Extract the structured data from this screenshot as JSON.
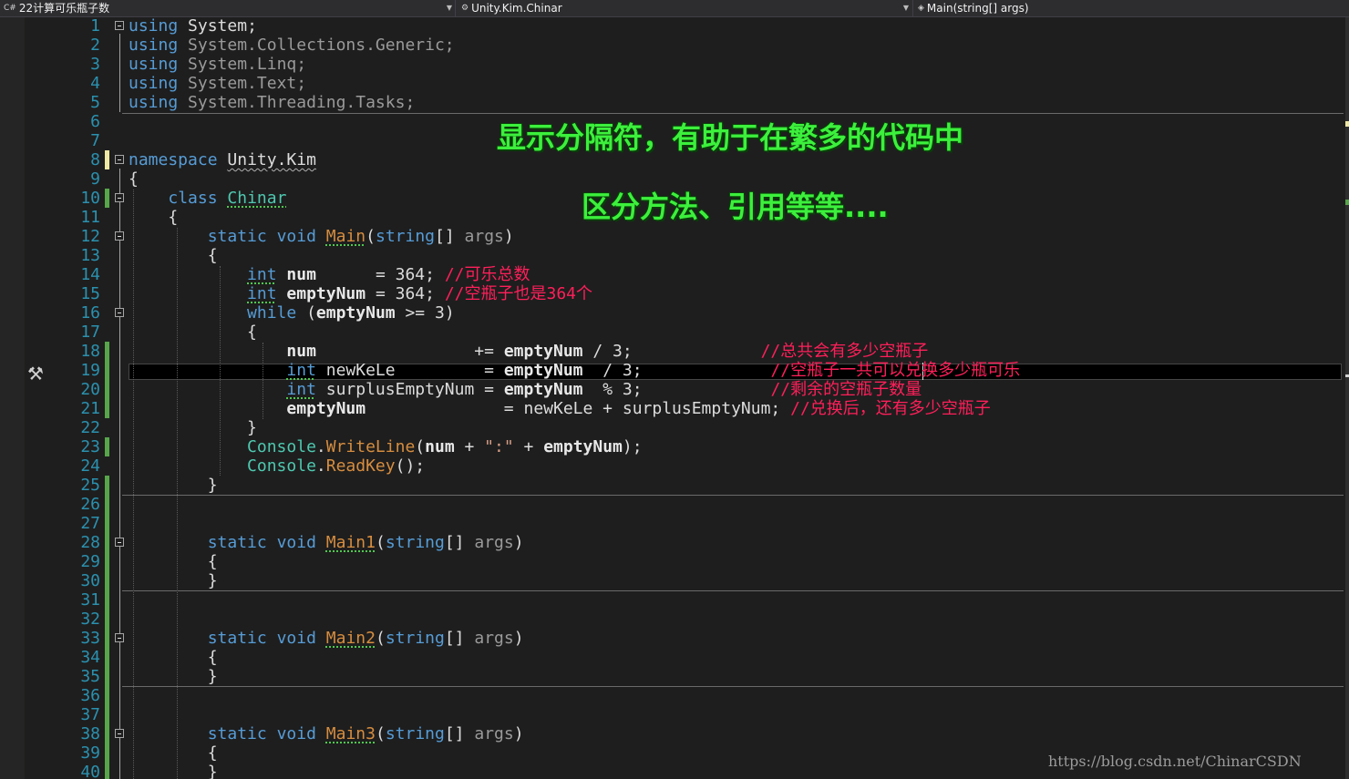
{
  "navbar": {
    "project_icon": "C#",
    "project": "22计算可乐瓶子数",
    "class_icon": "class-icon",
    "class_name": "Unity.Kim.Chinar",
    "member_icon": "method-icon",
    "member": "Main(string[] args)"
  },
  "overlay": {
    "line1": "显示分隔符，有助于在繁多的代码中",
    "line2": "区分方法、引用等等...."
  },
  "watermark": "https://blog.csdn.net/ChinarCSDN",
  "tool_icon": "hammer-icon",
  "line_numbers": [
    "1",
    "2",
    "3",
    "4",
    "5",
    "6",
    "7",
    "8",
    "9",
    "10",
    "11",
    "12",
    "13",
    "14",
    "15",
    "16",
    "17",
    "18",
    "19",
    "20",
    "21",
    "22",
    "23",
    "24",
    "25",
    "26",
    "27",
    "28",
    "29",
    "30",
    "31",
    "32",
    "33",
    "34",
    "35",
    "36",
    "37",
    "38",
    "39",
    "40"
  ],
  "code": {
    "using": "using",
    "ns_system": "System",
    "ns_collections": "System.Collections.Generic",
    "ns_linq": "System.Linq",
    "ns_text": "System.Text",
    "ns_tasks": "System.Threading.Tasks",
    "kw_namespace": "namespace",
    "ns_name": "Unity.Kim",
    "kw_class": "class",
    "class_name": "Chinar",
    "kw_static": "static",
    "kw_void": "void",
    "kw_string": "string",
    "kw_int": "int",
    "kw_while": "while",
    "m_main": "Main",
    "m_main1": "Main1",
    "m_main2": "Main2",
    "m_main3": "Main3",
    "args": "args",
    "var_num": "num",
    "var_empty": "emptyNum",
    "var_newkele": "newKeLe",
    "var_surplus": "surplusEmptyNum",
    "val_364": "364",
    "val_3": "3",
    "comment_14": "//可乐总数",
    "comment_15": "//空瓶子也是364个",
    "comment_18": "//总共会有多少空瓶子",
    "comment_19": "//空瓶子一共可以兑换多少瓶可乐",
    "comment_20": "//剩余的空瓶子数量",
    "comment_21": "//兑换后，还有多少空瓶子",
    "console": "Console",
    "m_writeline": "WriteLine",
    "m_readkey": "ReadKey",
    "str_colon": "\":\""
  },
  "colors": {
    "keyword": "#569cd6",
    "type": "#4ec9b0",
    "method": "#d68d3f",
    "comment": "#ff1f5a",
    "line_number": "#2b91af",
    "overlay": "#3cf03c"
  }
}
